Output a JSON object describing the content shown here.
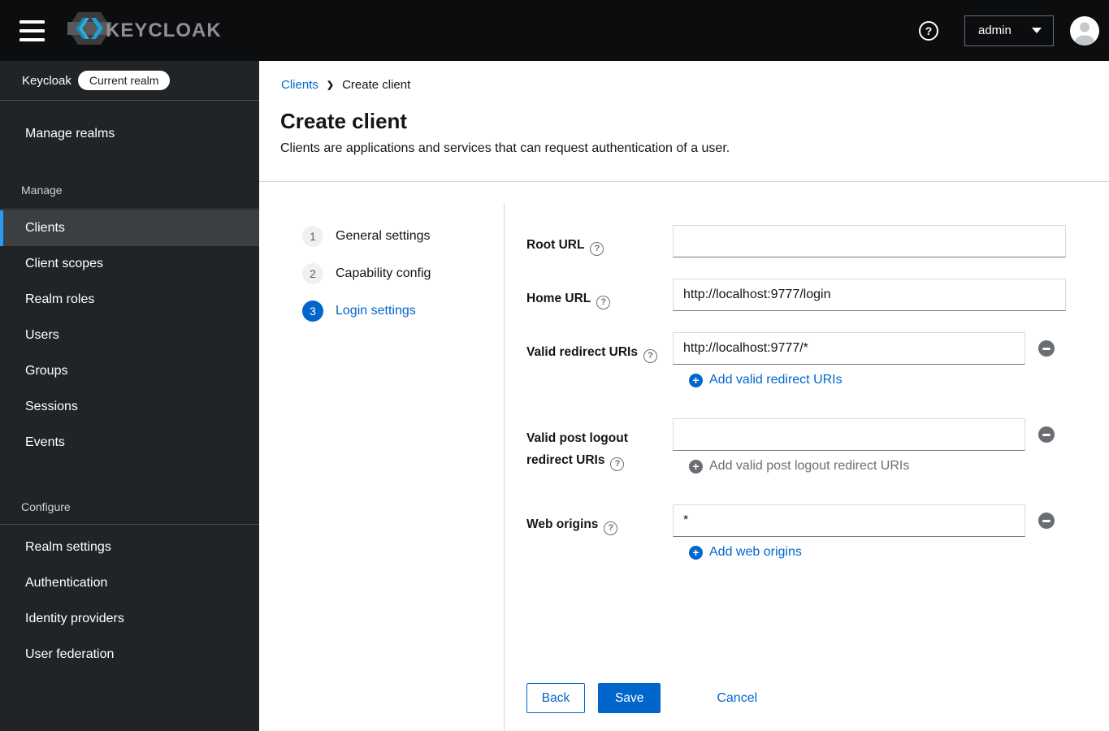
{
  "masthead": {
    "brand_text": "KEYCLOAK",
    "help_icon": "?",
    "user_menu_label": "admin"
  },
  "sidebar": {
    "realm_label": "Keycloak",
    "realm_badge": "Current realm",
    "manage_realms_label": "Manage realms",
    "sections": [
      {
        "label": "Manage",
        "items": [
          "Clients",
          "Client scopes",
          "Realm roles",
          "Users",
          "Groups",
          "Sessions",
          "Events"
        ],
        "selected_item": "Clients"
      },
      {
        "label": "Configure",
        "items": [
          "Realm settings",
          "Authentication",
          "Identity providers",
          "User federation"
        ]
      }
    ]
  },
  "breadcrumb": {
    "parent": "Clients",
    "current": "Create client"
  },
  "page_header": {
    "title": "Create client",
    "subtitle": "Clients are applications and services that can request authentication of a user."
  },
  "wizard": {
    "active_step_label": "Login settings",
    "steps": [
      {
        "number": "1",
        "label": "General settings"
      },
      {
        "number": "2",
        "label": "Capability config"
      },
      {
        "number": "3",
        "label": "Login settings"
      }
    ]
  },
  "form": {
    "fields": [
      {
        "label": "Root URL",
        "value": ""
      },
      {
        "label": "Home URL",
        "value": "http://localhost:9777/login"
      },
      {
        "label": "Valid redirect URIs",
        "value": "http://localhost:9777/*",
        "add_label": "Add valid redirect URIs",
        "add_enabled": true
      },
      {
        "label": "Valid post logout redirect URIs",
        "value": "",
        "add_label": "Add valid post logout redirect URIs",
        "add_enabled": false
      },
      {
        "label": "Web origins",
        "value": "*",
        "add_label": "Add web origins",
        "add_enabled": true
      }
    ],
    "footer": {
      "back": "Back",
      "save": "Save",
      "cancel": "Cancel"
    }
  },
  "colors": {
    "primary_blue": "#0066cc",
    "nav_selected_indicator": "#2b9af3",
    "masthead_bg": "#0c0d0f",
    "sidebar_bg": "#212427"
  }
}
